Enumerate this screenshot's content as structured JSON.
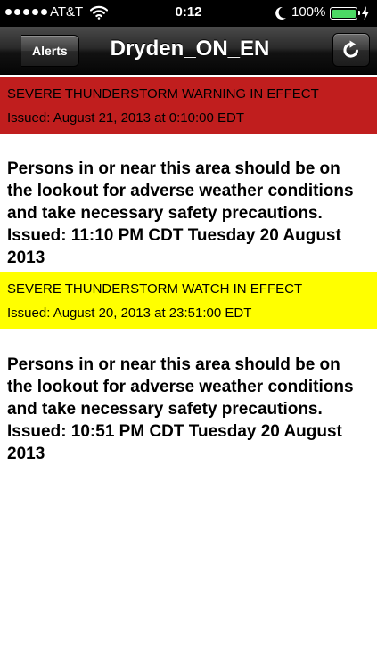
{
  "status_bar": {
    "carrier": "AT&T",
    "time": "0:12",
    "battery_percent": "100%",
    "signal_dots": 5,
    "battery_level": 1.0
  },
  "nav_bar": {
    "back_label": "Alerts",
    "title": "Dryden_ON_EN",
    "refresh_icon": "refresh-icon"
  },
  "alerts": [
    {
      "headline": "SEVERE THUNDERSTORM WARNING IN EFFECT",
      "issued": "Issued: August 21, 2013 at 0:10:00 EDT",
      "color": "#c01e1e",
      "body": "Persons in or near this area should be on the lookout for adverse weather conditions and take necessary safety precautions. Issued: 11:10 PM CDT Tuesday 20 August 2013"
    },
    {
      "headline": "SEVERE THUNDERSTORM WATCH IN EFFECT",
      "issued": "Issued: August 20, 2013 at 23:51:00 EDT",
      "color": "#ffff00",
      "body": "Persons in or near this area should be on the lookout for adverse weather conditions and take necessary safety precautions. Issued: 10:51 PM CDT Tuesday 20 August 2013"
    }
  ],
  "colors": {
    "status_bar_bg": "#000000",
    "battery_fill": "#4cd964",
    "warning": "#c01e1e",
    "watch": "#ffff00"
  }
}
